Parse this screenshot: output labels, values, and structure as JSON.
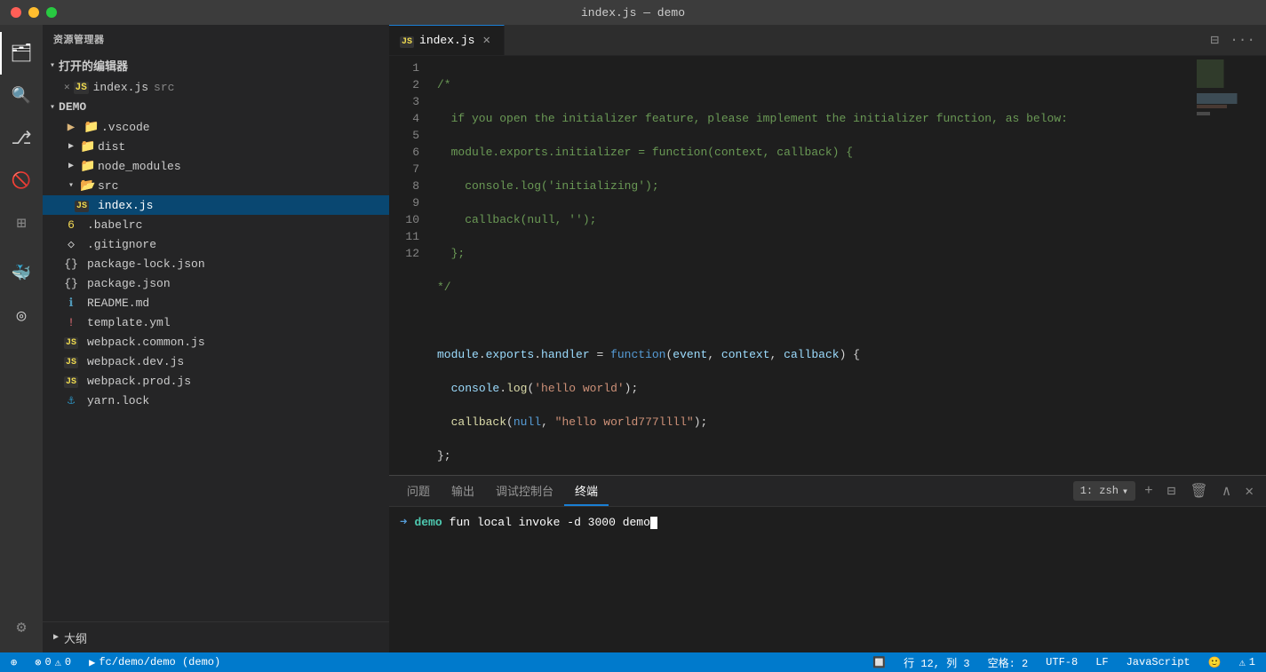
{
  "titlebar": {
    "title": "index.js — demo"
  },
  "activityBar": {
    "items": [
      {
        "name": "explorer",
        "icon": "⊞",
        "active": true
      },
      {
        "name": "search",
        "icon": "🔍"
      },
      {
        "name": "git",
        "icon": "⑂"
      },
      {
        "name": "debug",
        "icon": "⊘"
      },
      {
        "name": "extensions",
        "icon": "⊞2"
      },
      {
        "name": "docker",
        "icon": "🐳"
      },
      {
        "name": "remote",
        "icon": "◎"
      }
    ],
    "bottomItems": [
      {
        "name": "settings",
        "icon": "⚙"
      }
    ]
  },
  "sidebar": {
    "header": "资源管理器",
    "sections": {
      "openEditors": {
        "label": "打开的编辑器",
        "files": [
          {
            "name": "index.js",
            "extra": "src",
            "active": true
          }
        ]
      },
      "demo": {
        "label": "DEMO",
        "items": [
          {
            "name": ".vscode",
            "type": "folder",
            "indent": 1
          },
          {
            "name": "dist",
            "type": "folder",
            "indent": 1
          },
          {
            "name": "node_modules",
            "type": "folder",
            "indent": 1
          },
          {
            "name": "src",
            "type": "folder-open",
            "indent": 1
          },
          {
            "name": "index.js",
            "type": "js",
            "indent": 2,
            "active": true
          },
          {
            "name": ".babelrc",
            "type": "babel",
            "indent": 1
          },
          {
            "name": ".gitignore",
            "type": "git",
            "indent": 1
          },
          {
            "name": "package-lock.json",
            "type": "json",
            "indent": 1
          },
          {
            "name": "package.json",
            "type": "json",
            "indent": 1
          },
          {
            "name": "README.md",
            "type": "md",
            "indent": 1
          },
          {
            "name": "template.yml",
            "type": "yaml",
            "indent": 1
          },
          {
            "name": "webpack.common.js",
            "type": "js",
            "indent": 1
          },
          {
            "name": "webpack.dev.js",
            "type": "js",
            "indent": 1
          },
          {
            "name": "webpack.prod.js",
            "type": "js",
            "indent": 1
          },
          {
            "name": "yarn.lock",
            "type": "yarn",
            "indent": 1
          }
        ]
      }
    },
    "outline": {
      "label": "大纲"
    }
  },
  "editor": {
    "tabs": [
      {
        "label": "index.js",
        "active": true,
        "icon": "js"
      }
    ],
    "filename": "index.js",
    "lines": [
      {
        "num": 1,
        "content": "/*"
      },
      {
        "num": 2,
        "content": "  if you open the initializer feature, please implement the initializer function, as below:"
      },
      {
        "num": 3,
        "content": "  module.exports.initializer = function(context, callback) {"
      },
      {
        "num": 4,
        "content": "    console.log('initializing');"
      },
      {
        "num": 5,
        "content": "    callback(null, '');"
      },
      {
        "num": 6,
        "content": "  };"
      },
      {
        "num": 7,
        "content": "*/"
      },
      {
        "num": 8,
        "content": ""
      },
      {
        "num": 9,
        "content": "module.exports.handler = function(event, context, callback) {"
      },
      {
        "num": 10,
        "content": "  console.log('hello world');"
      },
      {
        "num": 11,
        "content": "  callback(null, \"hello world777llll\");"
      },
      {
        "num": 12,
        "content": "};"
      }
    ]
  },
  "panel": {
    "tabs": [
      {
        "label": "问题"
      },
      {
        "label": "输出"
      },
      {
        "label": "调试控制台"
      },
      {
        "label": "终端",
        "active": true
      }
    ],
    "terminalSelector": "1: zsh",
    "terminal": {
      "prompt": "➜",
      "user": "demo",
      "command": "fun local invoke -d 3000 demo"
    }
  },
  "statusBar": {
    "left": [
      {
        "icon": "⊕",
        "text": "0"
      },
      {
        "icon": "⚠",
        "text": "0"
      },
      {
        "text": "▶ fc/demo/demo (demo)"
      }
    ],
    "right": [
      {
        "text": "🔲"
      },
      {
        "text": "行 12, 列 3"
      },
      {
        "text": "空格: 2"
      },
      {
        "text": "UTF-8"
      },
      {
        "text": "LF"
      },
      {
        "text": "JavaScript"
      },
      {
        "text": "😊"
      },
      {
        "text": "⚠ 1"
      }
    ]
  }
}
